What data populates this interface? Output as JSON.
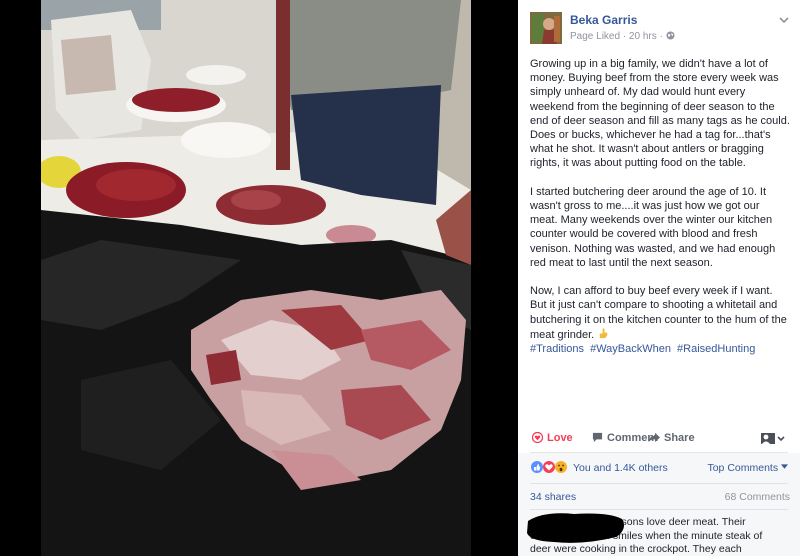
{
  "post": {
    "author": "Beka Garris",
    "meta": "Page Liked · 20 hrs · ",
    "paragraphs": [
      "Growing up in a big family, we didn't have a lot of money. Buying beef from the store every week was simply unheard of. My dad would hunt every weekend from the beginning of deer season to the end of deer season and fill as many tags as he could. Does or bucks, whichever he had a tag for...that's what he shot. It wasn't about antlers or bragging rights, it was about putting food on the table.",
      "I started butchering deer around the age of 10. It wasn't gross to me....it was just how we got our meat. Many weekends over the winter our kitchen counter would be covered with blood and fresh venison. Nothing was wasted, and we had enough red meat to last until the next season.",
      "Now, I can afford to buy beef every week if I want. But it just can't compare to shooting a whitetail and butchering it on the kitchen counter to the hum of the meat grinder."
    ],
    "hashtags": [
      "#Traditions",
      "#WayBackWhen",
      "#RaisedHunting"
    ]
  },
  "actions": {
    "love": "Love",
    "comment": "Comment",
    "share": "Share"
  },
  "reactions": {
    "text": "You and 1.4K others",
    "top_comments": "Top Comments"
  },
  "stats": {
    "shares": "34 shares",
    "comments": "68 Comments"
  },
  "comment": {
    "text": "ly four sons love deer meat. Their childhood was all smiles when the minute steak of deer were cooking in the crockpot. They each"
  },
  "colors": {
    "link": "#365899",
    "love": "#f33e58",
    "like": "#5890ff",
    "wow": "#f7b125"
  }
}
